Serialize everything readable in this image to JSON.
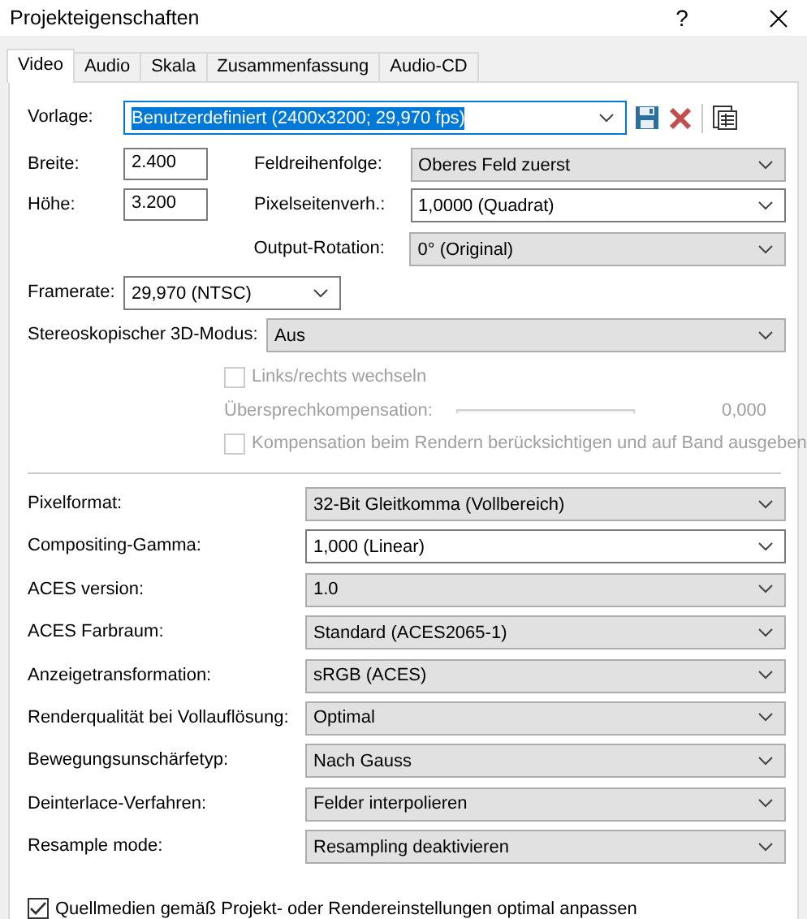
{
  "window": {
    "title": "Projekteigenschaften",
    "help": "?"
  },
  "tabs": [
    {
      "label": "Video",
      "selected": true
    },
    {
      "label": "Audio",
      "selected": false
    },
    {
      "label": "Skala",
      "selected": false
    },
    {
      "label": "Zusammenfassung",
      "selected": false
    },
    {
      "label": "Audio-CD",
      "selected": false
    }
  ],
  "template": {
    "label": "Vorlage:",
    "value": "Benutzerdefiniert (2400x3200; 29,970 fps)",
    "highlighted": true
  },
  "size_fields": [
    {
      "label": "Breite:",
      "value": "2.400"
    },
    {
      "label": "Höhe:",
      "value": "3.200"
    }
  ],
  "field_options": [
    {
      "label": "Feldreihenfolge:",
      "value": "Oberes Feld zuerst",
      "kind": "list"
    },
    {
      "label": "Pixelseitenverh.:",
      "value": "1,0000 (Quadrat)",
      "kind": "edit"
    },
    {
      "label": "Output-Rotation:",
      "value": "0° (Original)",
      "kind": "list"
    }
  ],
  "framerate": {
    "label": "Framerate:",
    "value": "29,970 (NTSC)",
    "kind": "edit"
  },
  "stereo": {
    "label": "Stereoskopischer 3D-Modus:",
    "value": "Aus",
    "kind": "list"
  },
  "stereo_options": [
    {
      "kind": "checkbox",
      "label": "Links/rechts wechseln",
      "checked": false,
      "disabled": true
    },
    {
      "kind": "slider",
      "label": "Übersprechkompensation:",
      "reading": "0,000",
      "disabled": true
    },
    {
      "kind": "checkbox",
      "label": "Kompensation beim Rendern berücksichtigen und auf Band ausgeben",
      "checked": false,
      "disabled": true
    }
  ],
  "settings": [
    {
      "label": "Pixelformat:",
      "value": "32-Bit Gleitkomma (Vollbereich)",
      "kind": "list"
    },
    {
      "label": "Compositing-Gamma:",
      "value": "1,000 (Linear)",
      "kind": "edit"
    },
    {
      "label": "ACES version:",
      "value": "1.0",
      "kind": "list"
    },
    {
      "label": "ACES Farbraum:",
      "value": "Standard (ACES2065-1)",
      "kind": "list"
    },
    {
      "label": "Anzeigetransformation:",
      "value": "sRGB (ACES)",
      "kind": "list"
    },
    {
      "label": "Renderqualität bei Vollauflösung:",
      "value": "Optimal",
      "kind": "list"
    },
    {
      "label": "Bewegungsunschärfetyp:",
      "value": "Nach Gauss",
      "kind": "list"
    },
    {
      "label": "Deinterlace-Verfahren:",
      "value": "Felder interpolieren",
      "kind": "list"
    },
    {
      "label": "Resample mode:",
      "value": "Resampling deaktivieren",
      "kind": "list"
    }
  ],
  "adapt_media": {
    "label": "Quellmedien gemäß Projekt- oder Rendereinstellungen optimal anpassen",
    "checked": true
  }
}
